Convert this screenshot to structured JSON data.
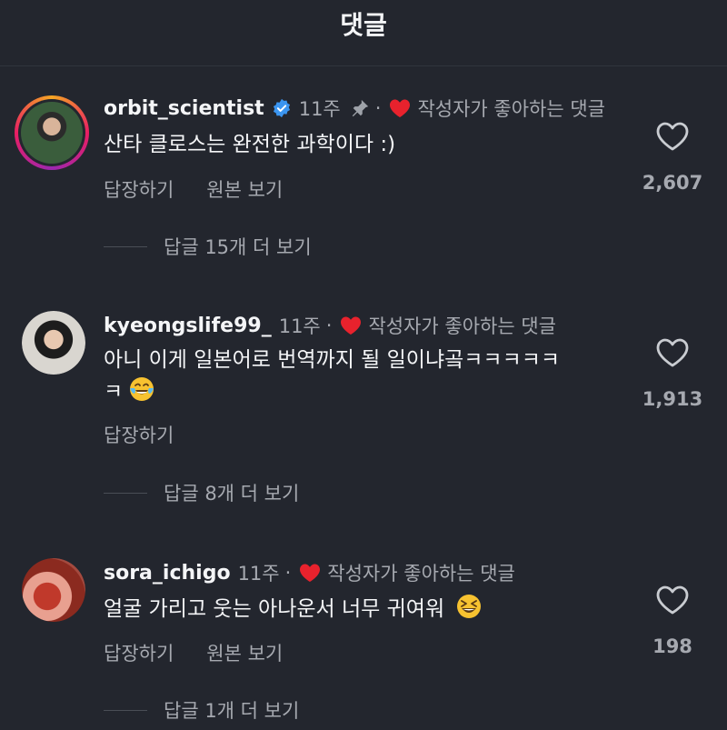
{
  "header": {
    "title": "댓글"
  },
  "comments": [
    {
      "username": "orbit_scientist",
      "verified": true,
      "time": "11주",
      "pinned": true,
      "liked_by_author": "작성자가 좋아하는 댓글",
      "text": "산타 클로스는 완전한 과학이다 :)",
      "reply_label": "답장하기",
      "original_label": "원본 보기",
      "replies_label": "답글 15개 더 보기",
      "likes": "2,607"
    },
    {
      "username": "kyeongslife99_",
      "verified": false,
      "time": "11주",
      "pinned": false,
      "liked_by_author": "작성자가 좋아하는 댓글",
      "text_line1": "아니 이게 일본어로 번역까지 될 일이냐곸ㅋㅋㅋㅋㅋ",
      "text_line2": "ㅋ",
      "emoji": "face-with-tears-of-joy",
      "reply_label": "답장하기",
      "replies_label": "답글 8개 더 보기",
      "likes": "1,913"
    },
    {
      "username": "sora_ichigo",
      "verified": false,
      "time": "11주",
      "pinned": false,
      "liked_by_author": "작성자가 좋아하는 댓글",
      "text": "얼굴 가리고 웃는 아나운서 너무 귀여워",
      "emoji": "grinning-squinting-face",
      "reply_label": "답장하기",
      "original_label": "원본 보기",
      "replies_label": "답글 1개 더 보기",
      "likes": "198"
    }
  ],
  "dot": "·",
  "colors": {
    "heart": "#e8222d",
    "verified": "#3b95f0",
    "bg": "#23262e",
    "muted": "#a6a9b0"
  }
}
